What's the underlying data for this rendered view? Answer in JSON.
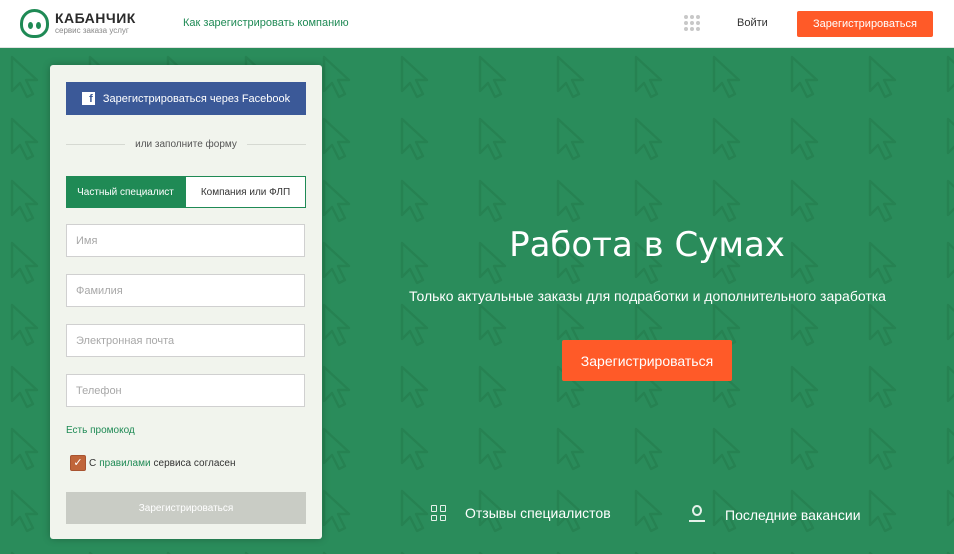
{
  "header": {
    "logo_title": "КАБАНЧИК",
    "logo_subtitle": "сервис заказа услуг",
    "company_link": "Как зарегистрировать компанию",
    "login": "Войти",
    "register_button": "Зарегистрироваться"
  },
  "form": {
    "facebook_button": "Зарегистрироваться через Facebook",
    "divider": "или заполните форму",
    "tabs": [
      {
        "label": "Частный специалист",
        "active": true
      },
      {
        "label": "Компания или ФЛП",
        "active": false
      }
    ],
    "fields": {
      "name_placeholder": "Имя",
      "surname_placeholder": "Фамилия",
      "email_placeholder": "Электронная почта",
      "phone_placeholder": "Телефон"
    },
    "promo": "Есть промокод",
    "agree_prefix": "С",
    "agree_link": "правилами",
    "agree_suffix": "сервиса согласен",
    "agree_checked": true,
    "submit": "Зарегистрироваться"
  },
  "hero": {
    "title": "Работа в Сумах",
    "subtitle": "Только актуальные заказы для подработки и дополнительного заработка",
    "button": "Зарегистрироваться"
  },
  "bottom_links": {
    "reviews": "Отзывы специалистов",
    "vacancies": "Последние вакансии"
  },
  "colors": {
    "brand_green": "#1f8a55",
    "background_green": "#2a8c5b",
    "accent_orange": "#ff5a28",
    "facebook_blue": "#3b5998"
  },
  "icons": [
    "logo-icon",
    "apps-grid-icon",
    "facebook-icon",
    "checkbox-check-icon",
    "grid-icon",
    "person-icon"
  ]
}
